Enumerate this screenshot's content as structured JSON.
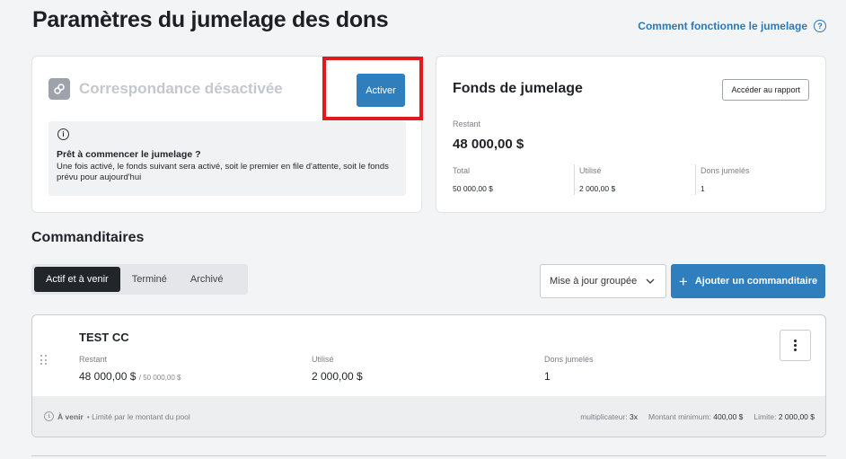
{
  "page": {
    "title": "Paramètres du jumelage des dons",
    "help_link": "Comment fonctionne le jumelage",
    "help_icon": "?"
  },
  "matching": {
    "status": "Correspondance désactivée",
    "icon": "link-icon",
    "activate_label": "Activer",
    "info_icon": "i",
    "info_title": "Prêt à commencer le jumelage ?",
    "info_text": "Une fois activé, le fonds suivant sera activé, soit le premier en file d'attente, soit le fonds prévu pour aujourd'hui"
  },
  "fund": {
    "title": "Fonds de jumelage",
    "report_label": "Accéder au rapport",
    "remaining_label": "Restant",
    "remaining_value": "48 000,00 $",
    "stats": [
      {
        "label": "Total",
        "value": "50 000,00 $"
      },
      {
        "label": "Utilisé",
        "value": "2 000,00 $"
      },
      {
        "label": "Dons jumelés",
        "value": "1"
      }
    ]
  },
  "sponsors": {
    "title": "Commanditaires",
    "tabs": [
      {
        "label": "Actif et à venir",
        "active": true
      },
      {
        "label": "Terminé",
        "active": false
      },
      {
        "label": "Archivé",
        "active": false
      }
    ],
    "bulk_update_label": "Mise à jour groupée",
    "add_label": "Ajouter un commanditaire",
    "items": [
      {
        "name": "TEST CC",
        "remaining_label": "Restant",
        "remaining_value": "48 000,00 $",
        "remaining_total": "/ 50 000,00 $",
        "used_label": "Utilisé",
        "used_value": "2 000,00 $",
        "matched_label": "Dons jumelés",
        "matched_value": "1",
        "status": "À venir",
        "status_note": "• Limité par le montant du pool",
        "multiplier_label": "multiplicateur:",
        "multiplier_value": "3x",
        "minimum_label": "Montant minimum:",
        "minimum_value": "400,00 $",
        "limit_label": "Limite:",
        "limit_value": "2 000,00 $"
      }
    ]
  },
  "colors": {
    "primary": "#2f7fbf",
    "highlight": "#e2191f",
    "dark_tab": "#222529"
  }
}
